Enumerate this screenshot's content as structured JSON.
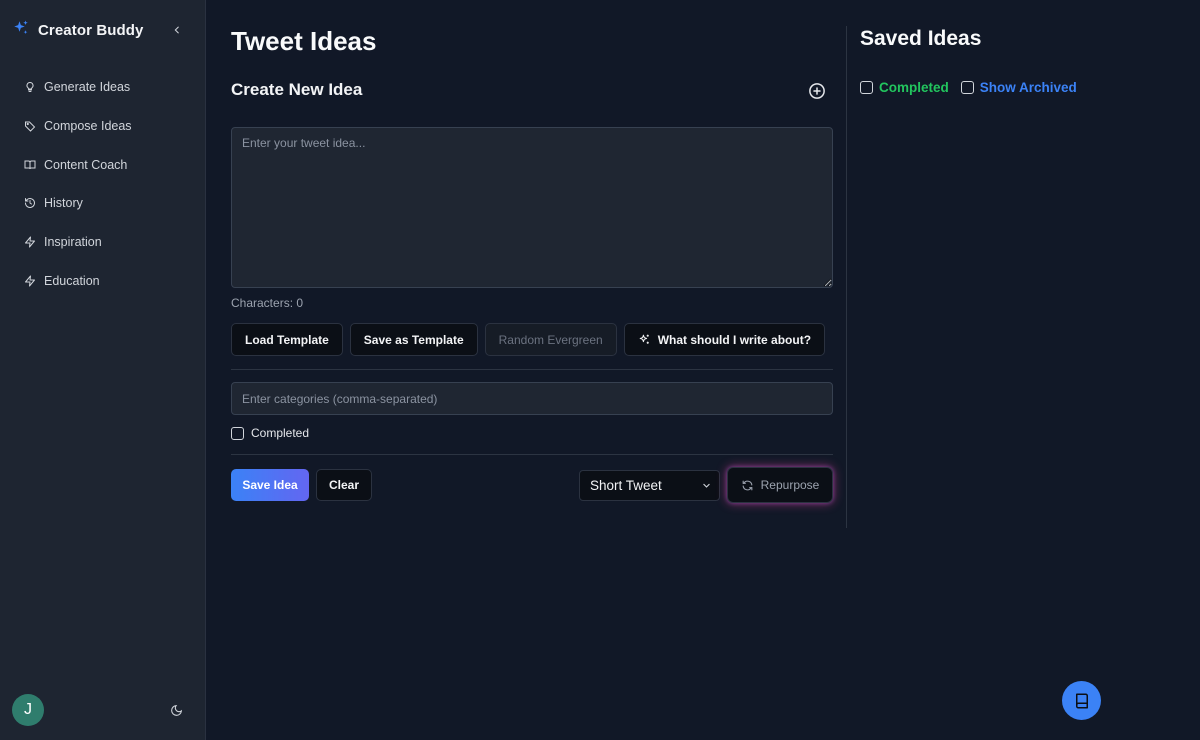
{
  "app": {
    "title": "Creator Buddy"
  },
  "sidebar": {
    "items": [
      {
        "label": "Generate Ideas",
        "icon": "lightbulb-icon"
      },
      {
        "label": "Compose Ideas",
        "icon": "tag-icon"
      },
      {
        "label": "Content Coach",
        "icon": "book-open-icon"
      },
      {
        "label": "History",
        "icon": "history-icon"
      },
      {
        "label": "Inspiration",
        "icon": "bolt-icon"
      },
      {
        "label": "Education",
        "icon": "bolt-icon"
      }
    ],
    "avatar_initial": "J"
  },
  "main": {
    "page_title": "Tweet Ideas",
    "section_title": "Create New Idea",
    "idea_placeholder": "Enter your tweet idea...",
    "char_count_label": "Characters: 0",
    "buttons": {
      "load_template": "Load Template",
      "save_template": "Save as Template",
      "random_evergreen": "Random Evergreen",
      "what_to_write": "What should I write about?"
    },
    "categories_placeholder": "Enter categories (comma-separated)",
    "completed_label": "Completed",
    "save_idea": "Save Idea",
    "clear": "Clear",
    "format_select": "Short Tweet",
    "repurpose": "Repurpose"
  },
  "saved": {
    "title": "Saved Ideas",
    "filter_completed": "Completed",
    "filter_archived": "Show Archived"
  },
  "colors": {
    "background": "#111827",
    "sidebar": "#1e2531",
    "accent_blue": "#3b82f6",
    "accent_green": "#22c55e"
  }
}
